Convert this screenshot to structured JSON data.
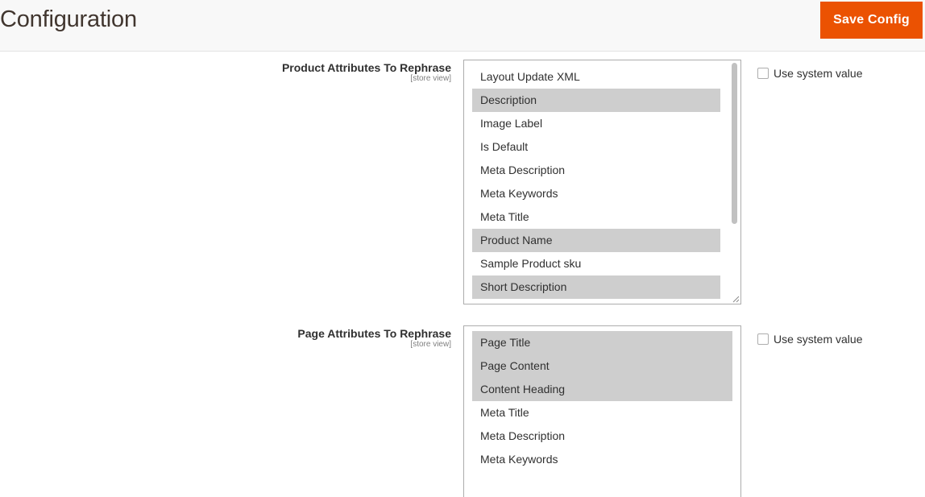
{
  "header": {
    "title": "Configuration",
    "save_label": "Save Config"
  },
  "colors": {
    "accent": "#eb5202",
    "selected_option_bg": "#cecece",
    "header_bg": "#f8f8f8"
  },
  "fields": [
    {
      "label": "Product Attributes To Rephrase",
      "scope": "[store view]",
      "options": [
        {
          "label": "Layout Update XML",
          "selected": false
        },
        {
          "label": "Description",
          "selected": true
        },
        {
          "label": "Image Label",
          "selected": false
        },
        {
          "label": "Is Default",
          "selected": false
        },
        {
          "label": "Meta Description",
          "selected": false
        },
        {
          "label": "Meta Keywords",
          "selected": false
        },
        {
          "label": "Meta Title",
          "selected": false
        },
        {
          "label": "Product Name",
          "selected": true
        },
        {
          "label": "Sample Product sku",
          "selected": false
        },
        {
          "label": "Short Description",
          "selected": true
        }
      ],
      "use_system_value_label": "Use system value",
      "use_system_value_checked": false
    },
    {
      "label": "Page Attributes To Rephrase",
      "scope": "[store view]",
      "options": [
        {
          "label": "Page Title",
          "selected": true
        },
        {
          "label": "Page Content",
          "selected": true
        },
        {
          "label": "Content Heading",
          "selected": true
        },
        {
          "label": "Meta Title",
          "selected": false
        },
        {
          "label": "Meta Description",
          "selected": false
        },
        {
          "label": "Meta Keywords",
          "selected": false
        }
      ],
      "use_system_value_label": "Use system value",
      "use_system_value_checked": false
    }
  ]
}
